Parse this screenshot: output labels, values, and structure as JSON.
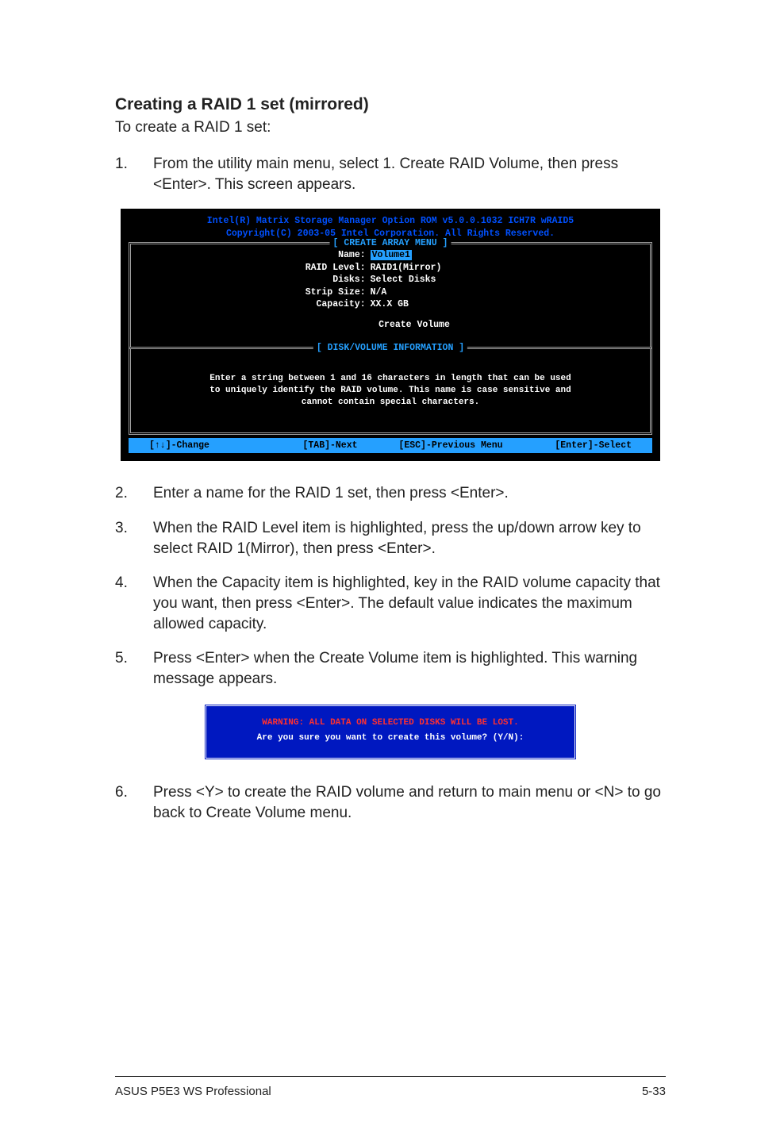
{
  "section": {
    "title": "Creating a RAID 1 set (mirrored)",
    "intro": "To create a RAID 1 set:"
  },
  "step1": {
    "num": "1.",
    "text": "From the utility main menu, select 1. Create RAID Volume, then press <Enter>. This screen appears."
  },
  "bios": {
    "header1": "Intel(R) Matrix Storage Manager Option ROM v5.0.0.1032 ICH7R wRAID5",
    "header2": "Copyright(C) 2003-05 Intel Corporation. All Rights Reserved.",
    "menu_title": "[ CREATE ARRAY MENU ]",
    "fields": {
      "name_k": "Name:",
      "name_v": "Volume1",
      "raid_k": "RAID Level:",
      "raid_v": "RAID1(Mirror)",
      "disks_k": "Disks:",
      "disks_v": "Select Disks",
      "strip_k": "Strip Size:",
      "strip_v": "N/A",
      "cap_k": "Capacity:",
      "cap_v": "XX.X  GB"
    },
    "create_volume": "Create Volume",
    "info_title": "[ DISK/VOLUME INFORMATION ]",
    "info_l1": "Enter a string between 1 and 16 characters in length that can be used",
    "info_l2": "to uniquely identify the RAID volume. This name is case sensitive and",
    "info_l3": "cannot contain special characters.",
    "footer": {
      "a": "[↑↓]-Change",
      "b": "[TAB]-Next",
      "c": "[ESC]-Previous Menu",
      "d": "[Enter]-Select"
    }
  },
  "step2": {
    "num": "2.",
    "text": "Enter a name for the RAID 1 set, then press <Enter>."
  },
  "step3": {
    "num": "3.",
    "text": "When the RAID Level item is highlighted, press the up/down arrow key to select RAID 1(Mirror), then press <Enter>."
  },
  "step4": {
    "num": "4.",
    "text": "When the Capacity item is highlighted, key in the RAID volume capacity that you want, then press <Enter>. The default value indicates the maximum allowed capacity."
  },
  "step5": {
    "num": "5.",
    "text": "Press <Enter> when the Create Volume item is highlighted. This warning message appears."
  },
  "warning": {
    "line1": "WARNING: ALL DATA ON SELECTED DISKS WILL BE LOST.",
    "line2": "Are you sure you want to create this volume? (Y/N):"
  },
  "step6": {
    "num": "6.",
    "text": "Press <Y> to create the RAID volume and return to main menu or <N> to go back to Create Volume menu."
  },
  "footer": {
    "left": "ASUS P5E3 WS Professional",
    "right": "5-33"
  }
}
